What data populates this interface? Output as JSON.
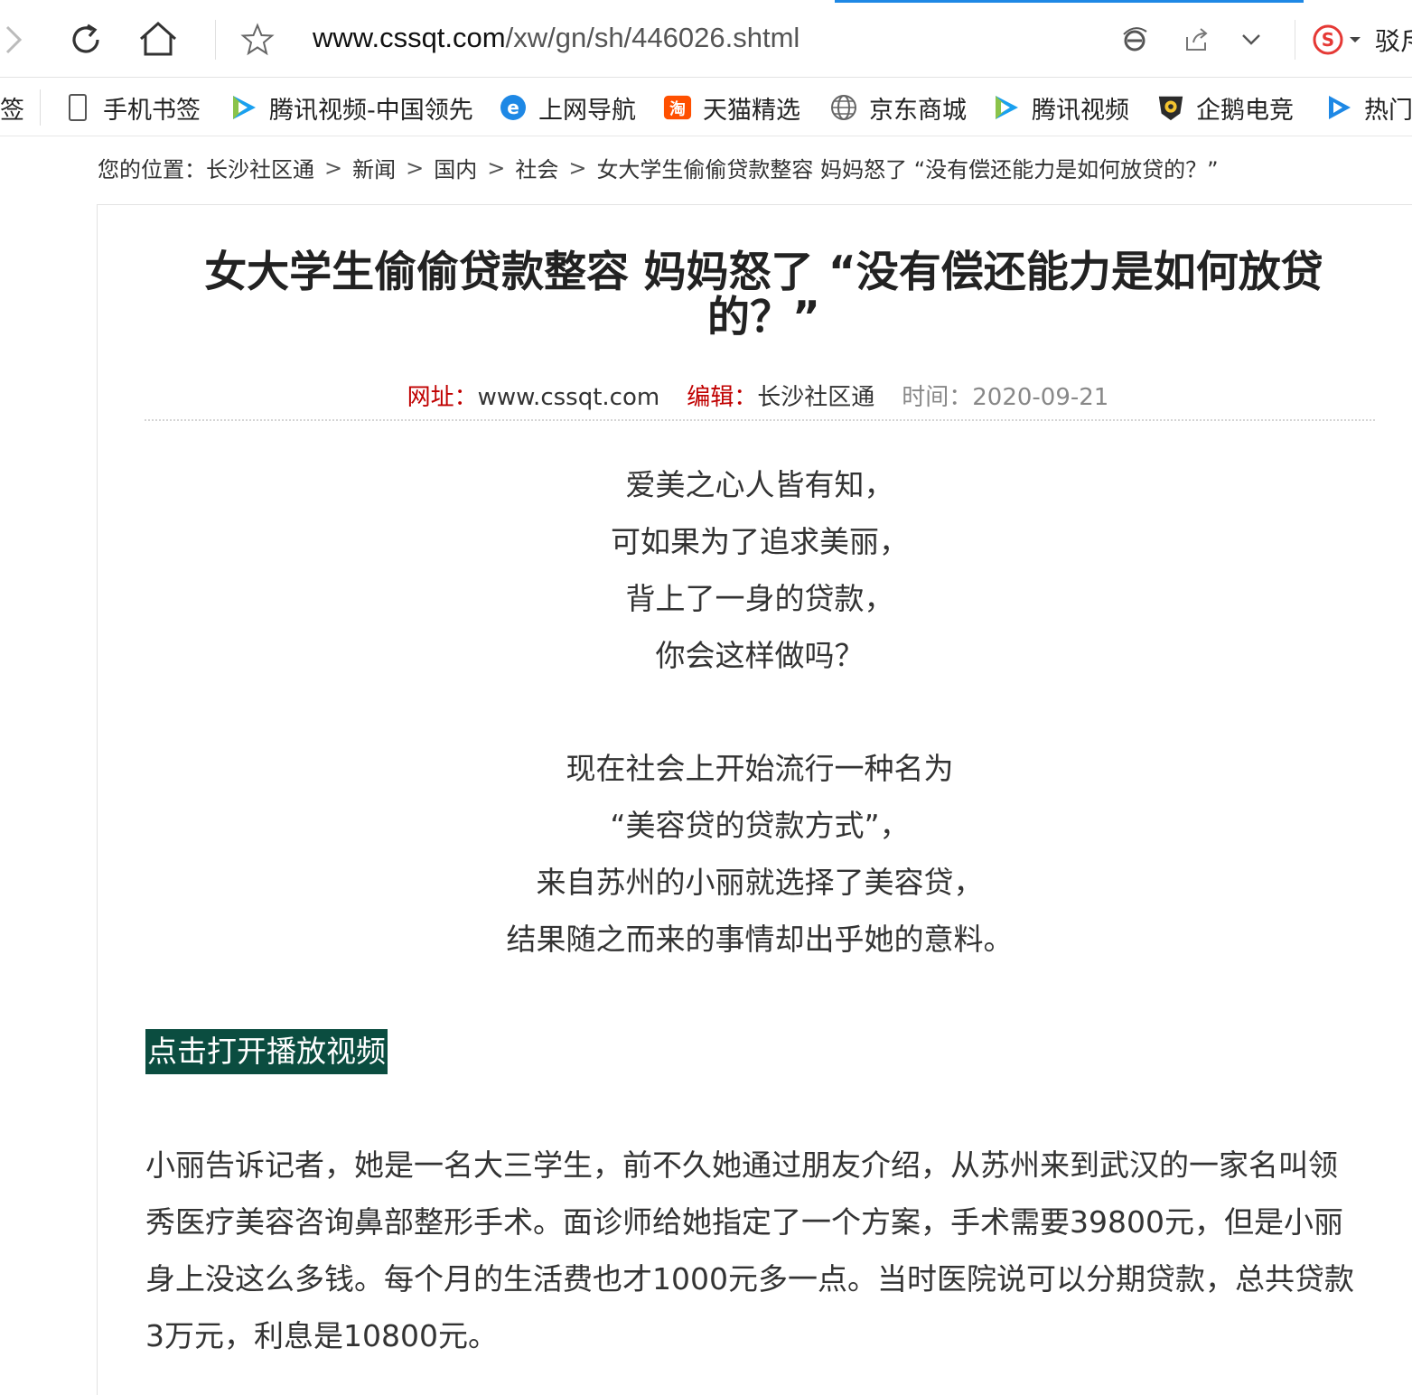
{
  "browser": {
    "url_domain": "www.cssqt.com",
    "url_path": "/xw/gn/sh/446026.shtml",
    "search_engine_label": "驳斥"
  },
  "bookmarks": [
    {
      "label": "签",
      "icon": "bookmark-partial"
    },
    {
      "label": "手机书签",
      "icon": "phone-icon"
    },
    {
      "label": "腾讯视频-中国领先",
      "icon": "tencent-video-icon"
    },
    {
      "label": "上网导航",
      "icon": "ie-icon"
    },
    {
      "label": "天猫精选",
      "icon": "tmall-icon"
    },
    {
      "label": "京东商城",
      "icon": "globe-icon"
    },
    {
      "label": "腾讯视频",
      "icon": "tencent-video-icon"
    },
    {
      "label": "企鹅电竞",
      "icon": "penguin-esports-icon"
    },
    {
      "label": "热门",
      "icon": "play-icon"
    }
  ],
  "breadcrumb": {
    "prefix": "您的位置：",
    "items": [
      "长沙社区通",
      "新闻",
      "国内",
      "社会",
      "女大学生偷偷贷款整容 妈妈怒了 “没有偿还能力是如何放贷的？”"
    ],
    "separator": ">"
  },
  "article": {
    "title": "女大学生偷偷贷款整容 妈妈怒了 “没有偿还能力是如何放贷的？”",
    "meta": {
      "site_label": "网址：",
      "site_value": "www.cssqt.com",
      "editor_label": "编辑：",
      "editor_value": "长沙社区通",
      "time_label": "时间：",
      "time_value": "2020-09-21"
    },
    "poem1": [
      "爱美之心人皆有知，",
      "可如果为了追求美丽，",
      "背上了一身的贷款，",
      "你会这样做吗？"
    ],
    "poem2": [
      "现在社会上开始流行一种名为",
      "“美容贷的贷款方式”，",
      "来自苏州的小丽就选择了美容贷，",
      "结果随之而来的事情却出乎她的意料。"
    ],
    "video_link": "点击打开播放视频",
    "paragraph": "小丽告诉记者，她是一名大三学生，前不久她通过朋友介绍，从苏州来到武汉的一家名叫领秀医疗美容咨询鼻部整形手术。面诊师给她指定了一个方案，手术需要39800元，但是小丽身上没这么多钱。每个月的生活费也才1000元多一点。当时医院说可以分期贷款，总共贷款3万元，利息是10800元。"
  },
  "colors": {
    "meta_label": "#c00000",
    "video_link_bg": "#0b4d40",
    "load_bar": "#1e88e5"
  }
}
